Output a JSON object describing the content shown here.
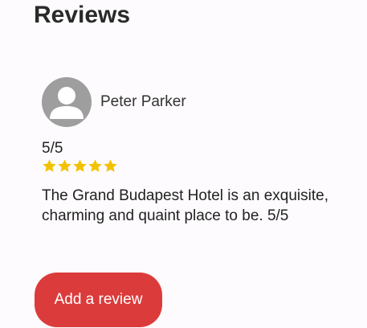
{
  "page": {
    "heading": "Reviews"
  },
  "review": {
    "author": "Peter Parker",
    "avatar_icon": "user-avatar-icon",
    "rating_text": "5/5",
    "stars": 5,
    "star_color": "#f2c200",
    "body": "The Grand Budapest Hotel is an exquisite, charming and quaint place to be. 5/5"
  },
  "actions": {
    "add_review_label": "Add a review",
    "button_color": "#dc3b3b"
  }
}
